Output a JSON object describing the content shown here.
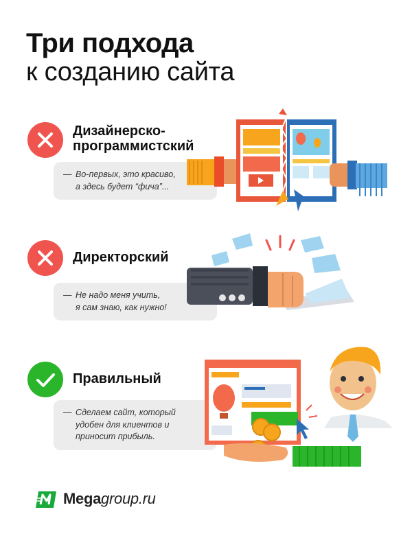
{
  "title": {
    "line1": "Три подхода",
    "line2": "к созданию сайта"
  },
  "sections": [
    {
      "status": "wrong",
      "icon": "cross-icon",
      "heading_line1": "Дизайнерско-",
      "heading_line2": "программистский",
      "quote_dash": "—",
      "quote_line1": "Во-первых, это красиво,",
      "quote_line2": "а здесь будет “фича”..."
    },
    {
      "status": "wrong",
      "icon": "cross-icon",
      "heading_line1": "Директорский",
      "quote_dash": "—",
      "quote_line1": "Не надо меня учить,",
      "quote_line2": "я сам знаю, как нужно!"
    },
    {
      "status": "correct",
      "icon": "check-icon",
      "heading_line1": "Правильный",
      "quote_dash": "—",
      "quote_line1": "Сделаем сайт, который",
      "quote_line2": "удобен для клиентов и",
      "quote_line3": "приносит прибыль."
    }
  ],
  "colors": {
    "wrong": "#f0544f",
    "correct": "#2bb52b",
    "quote_bg": "#ececec",
    "brand_green": "#1aaa3c"
  },
  "logo": {
    "bold": "Mega",
    "rest": "group.ru"
  }
}
